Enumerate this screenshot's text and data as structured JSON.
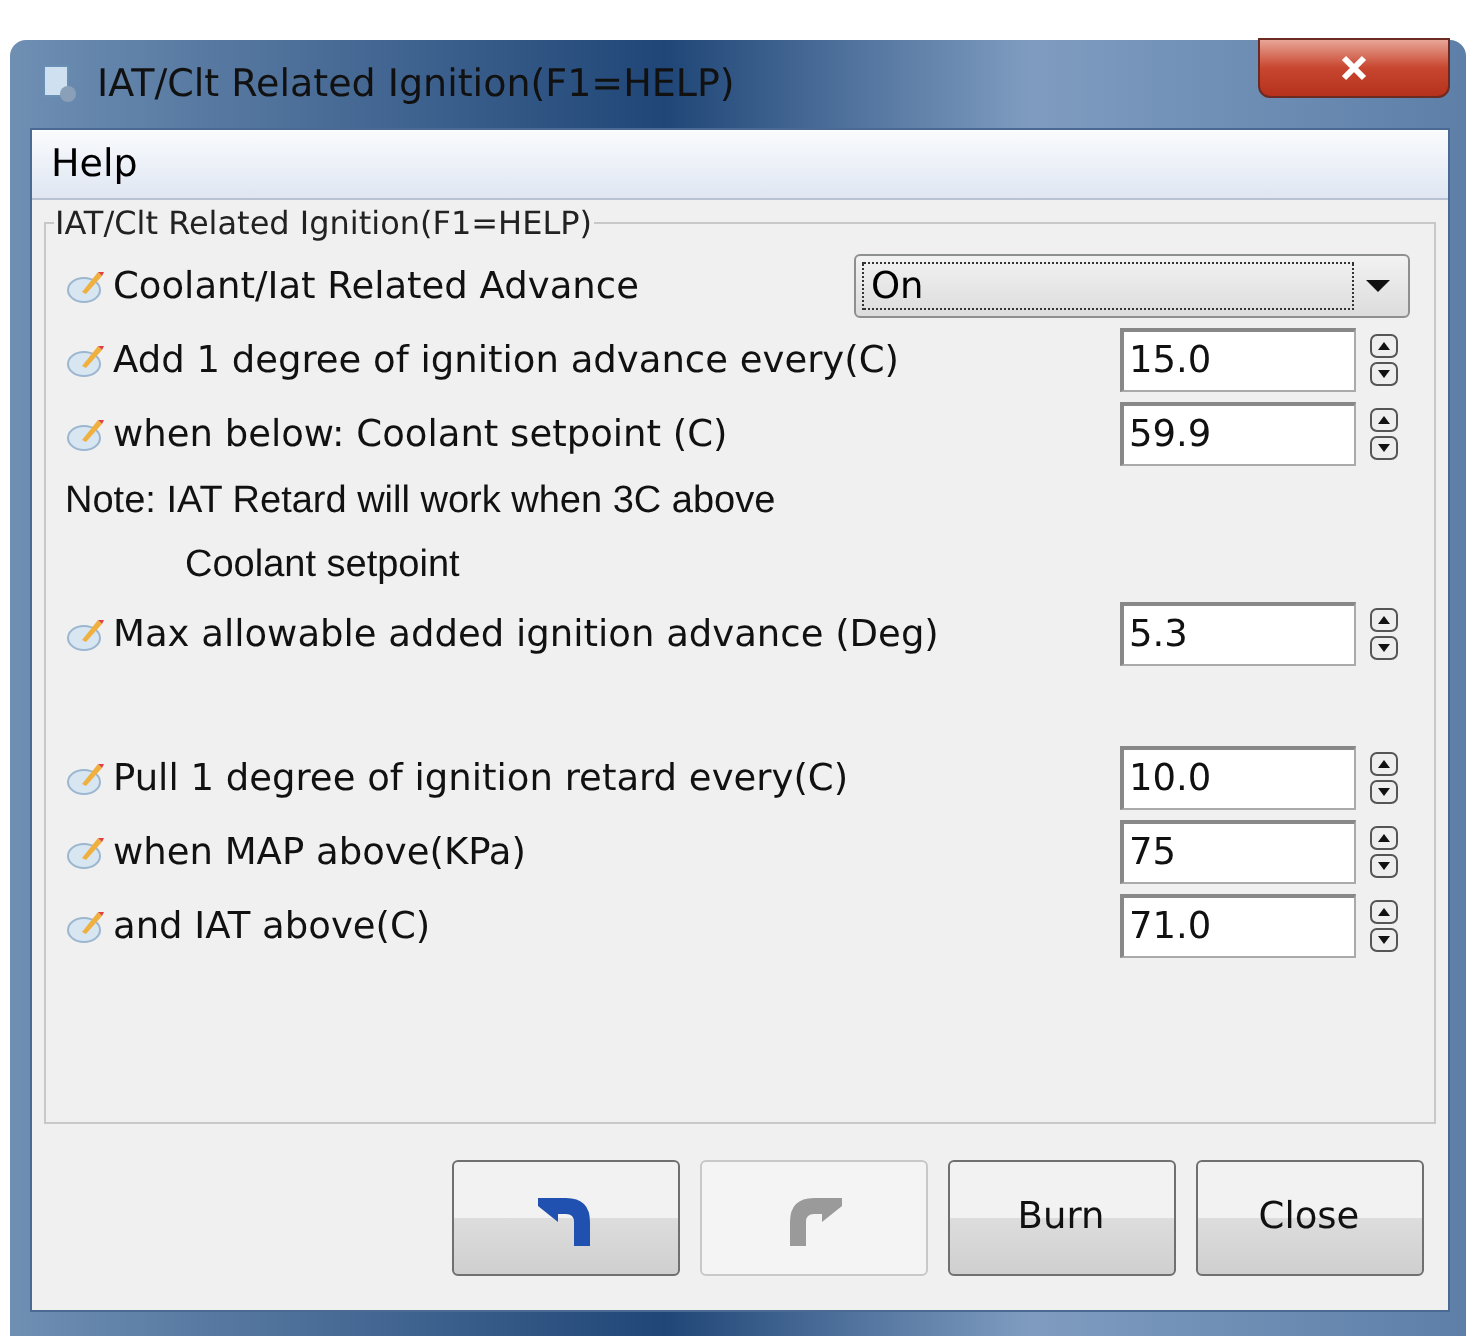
{
  "window": {
    "title": "IAT/Clt Related Ignition(F1=HELP)"
  },
  "menu": [
    "Help"
  ],
  "group": {
    "title": "IAT/Clt Related Ignition(F1=HELP)",
    "sections": [
      [
        {
          "kind": "select",
          "label": "Coolant/Iat Related Advance",
          "value": "On"
        },
        {
          "kind": "field",
          "label": "Add 1 degree of ignition advance every(C)",
          "value": "15.0"
        },
        {
          "kind": "field",
          "label": "when below: Coolant setpoint (C)",
          "value": "59.9"
        },
        {
          "kind": "note",
          "lines": [
            "Note: IAT Retard will work when 3C above",
            "Coolant setpoint"
          ]
        },
        {
          "kind": "field",
          "label": "Max allowable added ignition advance  (Deg)",
          "value": "5.3"
        }
      ],
      [
        {
          "kind": "field",
          "label": "Pull 1 degree of ignition retard every(C)",
          "value": "10.0"
        },
        {
          "kind": "field",
          "label": "when MAP above(KPa)",
          "value": "75"
        },
        {
          "kind": "field",
          "label": "and IAT above(C)",
          "value": "71.0"
        }
      ]
    ]
  },
  "buttons": [
    {
      "kind": "undo",
      "disabled": false
    },
    {
      "kind": "redo",
      "disabled": true
    },
    {
      "kind": "text",
      "label": "Burn",
      "disabled": false
    },
    {
      "kind": "text",
      "label": "Close",
      "disabled": false
    }
  ]
}
